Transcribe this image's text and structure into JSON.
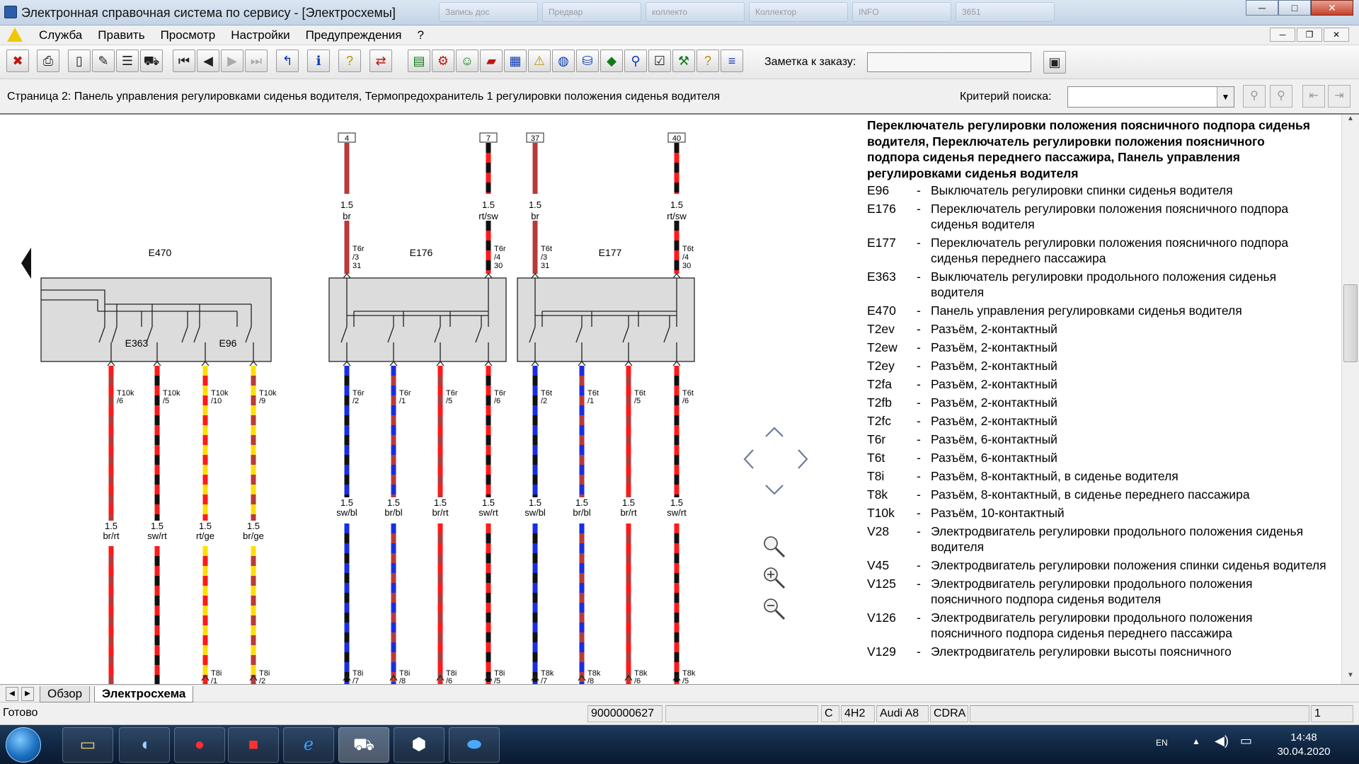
{
  "window": {
    "title": "Электронная справочная система по сервису - [Электросхемы]",
    "controls": {
      "minimize": "─",
      "maximize": "□",
      "close": "✕"
    },
    "background_tasks": [
      "Запись дос",
      "Предвар",
      "коллекто",
      "Коллектор",
      "INFO",
      "3651"
    ]
  },
  "menu": {
    "items": [
      "Служба",
      "Править",
      "Просмотр",
      "Настройки",
      "Предупреждения",
      "?"
    ],
    "mdi": {
      "minimize": "─",
      "restore": "❐",
      "close": "✕"
    }
  },
  "toolbar": {
    "note_label": "Заметка к заказу:",
    "note_value": ""
  },
  "infobar": {
    "page_title": "Страница 2: Панель управления регулировками сиденья водителя, Термопредохранитель 1 регулировки положения сиденья водителя",
    "search_label": "Критерий поиска:",
    "search_value": ""
  },
  "schematic": {
    "blocks": [
      {
        "name": "E470",
        "sub": [
          "E363",
          "E96"
        ]
      },
      {
        "name": "E176",
        "sub": []
      },
      {
        "name": "E177",
        "sub": []
      }
    ],
    "top_terminals": [
      "4",
      "7",
      "37",
      "40"
    ],
    "top_wires": [
      {
        "size": "1.5",
        "color": "br",
        "conn": "T6r",
        "pin": "/3",
        "num": "31"
      },
      {
        "size": "1.5",
        "color": "rt/sw",
        "conn": "T6r",
        "pin": "/4",
        "num": "30"
      },
      {
        "size": "1.5",
        "color": "br",
        "conn": "T6t",
        "pin": "/3",
        "num": "31"
      },
      {
        "size": "1.5",
        "color": "rt/sw",
        "conn": "T6t",
        "pin": "/4",
        "num": "30"
      }
    ],
    "lower_wires": [
      {
        "conn": "T10k",
        "pin": "/6",
        "size": "1.5",
        "color": "br/rt",
        "bottom": "",
        "bpin": ""
      },
      {
        "conn": "T10k",
        "pin": "/5",
        "size": "1.5",
        "color": "sw/rt",
        "bottom": "",
        "bpin": ""
      },
      {
        "conn": "T10k",
        "pin": "/10",
        "size": "1.5",
        "color": "rt/ge",
        "bottom": "T8i",
        "bpin": "/1"
      },
      {
        "conn": "T10k",
        "pin": "/9",
        "size": "1.5",
        "color": "br/ge",
        "bottom": "T8i",
        "bpin": "/2"
      },
      {
        "conn": "T6r",
        "pin": "/2",
        "size": "1.5",
        "color": "sw/bl",
        "bottom": "T8i",
        "bpin": "/7"
      },
      {
        "conn": "T6r",
        "pin": "/1",
        "size": "1.5",
        "color": "br/bl",
        "bottom": "T8i",
        "bpin": "/8"
      },
      {
        "conn": "T6r",
        "pin": "/5",
        "size": "1.5",
        "color": "br/rt",
        "bottom": "T8i",
        "bpin": "/6"
      },
      {
        "conn": "T6r",
        "pin": "/6",
        "size": "1.5",
        "color": "sw/rt",
        "bottom": "T8i",
        "bpin": "/5"
      },
      {
        "conn": "T6t",
        "pin": "/2",
        "size": "1.5",
        "color": "sw/bl",
        "bottom": "T8k",
        "bpin": "/7"
      },
      {
        "conn": "T6t",
        "pin": "/1",
        "size": "1.5",
        "color": "br/bl",
        "bottom": "T8k",
        "bpin": "/8"
      },
      {
        "conn": "T6t",
        "pin": "/5",
        "size": "1.5",
        "color": "br/rt",
        "bottom": "T8k",
        "bpin": "/6"
      },
      {
        "conn": "T6t",
        "pin": "/6",
        "size": "1.5",
        "color": "sw/rt",
        "bottom": "T8k",
        "bpin": "/5"
      }
    ],
    "wire_colors": {
      "br": "#b83a3a",
      "rt": "#ff1a1a",
      "sw": "#111111",
      "bl": "#1a2ee0",
      "ge": "#ffe000",
      "box": "#dcdcdc"
    }
  },
  "legend": {
    "heading": "Переключатель регулировки положения поясничного подпора сиденья водителя, Переключатель регулировки положения поясничного подпора сиденья переднего пассажира, Панель управления регулировками сиденья водителя",
    "items": [
      {
        "code": "E96",
        "desc": "Выключатель регулировки спинки сиденья водителя"
      },
      {
        "code": "E176",
        "desc": "Переключатель регулировки положения поясничного подпора сиденья водителя"
      },
      {
        "code": "E177",
        "desc": "Переключатель регулировки положения поясничного подпора сиденья переднего пассажира"
      },
      {
        "code": "E363",
        "desc": "Выключатель регулировки продольного положения сиденья водителя"
      },
      {
        "code": "E470",
        "desc": "Панель управления регулировками сиденья водителя"
      },
      {
        "code": "T2ev",
        "desc": "Разъём, 2-контактный"
      },
      {
        "code": "T2ew",
        "desc": "Разъём, 2-контактный"
      },
      {
        "code": "T2ey",
        "desc": "Разъём, 2-контактный"
      },
      {
        "code": "T2fa",
        "desc": "Разъём, 2-контактный"
      },
      {
        "code": "T2fb",
        "desc": "Разъём, 2-контактный"
      },
      {
        "code": "T2fc",
        "desc": "Разъём, 2-контактный"
      },
      {
        "code": "T6r",
        "desc": "Разъём, 6-контактный"
      },
      {
        "code": "T6t",
        "desc": "Разъём, 6-контактный"
      },
      {
        "code": "T8i",
        "desc": "Разъём, 8-контактный, в сиденье водителя"
      },
      {
        "code": "T8k",
        "desc": "Разъём, 8-контактный, в сиденье переднего пассажира"
      },
      {
        "code": "T10k",
        "desc": "Разъём, 10-контактный"
      },
      {
        "code": "V28",
        "desc": "Электродвигатель регулировки продольного положения сиденья водителя"
      },
      {
        "code": "V45",
        "desc": "Электродвигатель регулировки положения спинки сиденья водителя"
      },
      {
        "code": "V125",
        "desc": "Электродвигатель регулировки продольного положения поясничного подпора сиденья водителя"
      },
      {
        "code": "V126",
        "desc": "Электродвигатель регулировки продольного положения поясничного подпора сиденья переднего пассажира"
      },
      {
        "code": "V129",
        "desc": "Электродвигатель регулировки высоты поясничного"
      }
    ]
  },
  "tabs": [
    "Обзор",
    "Электросхема"
  ],
  "status": {
    "ready": "Готово",
    "order": "9000000627",
    "c": "C",
    "model_code": "4H2",
    "model": "Audi A8",
    "engine": "CDRA",
    "page": "1"
  },
  "taskbar": {
    "lang": "EN",
    "time": "14:48",
    "date": "30.04.2020"
  }
}
